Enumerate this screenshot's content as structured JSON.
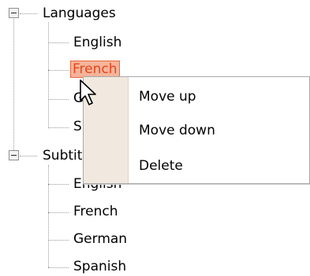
{
  "tree": {
    "groups": [
      {
        "label": "Languages",
        "expanded": true,
        "children": [
          "English",
          "French",
          "German",
          "Spanish"
        ]
      },
      {
        "label": "Subtitles",
        "expanded": true,
        "children": [
          "English",
          "French",
          "German",
          "Spanish"
        ]
      }
    ],
    "selected": "French"
  },
  "context_menu": {
    "items": [
      "Move up",
      "Move down",
      "Delete"
    ]
  },
  "icons": {
    "expander": "collapse-minus-icon",
    "cursor": "mouse-pointer-icon"
  },
  "colors": {
    "selection_bg": "#f6b49a",
    "selection_border": "#e8673b",
    "selection_text": "#e0471e",
    "menu_gutter": "#f1e9df"
  }
}
